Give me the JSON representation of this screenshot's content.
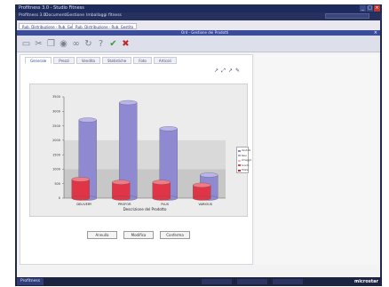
{
  "window": {
    "title": "Profitness 3.0 - Studio Fitness",
    "buttons": [
      "_",
      "□",
      "×"
    ]
  },
  "menubar": {
    "items": [
      "Profitness 3.0",
      "Documenti",
      "Gestione",
      "Imballaggi fitness"
    ]
  },
  "breadcrumbs": [
    "Rub. Distribuzione - Rub. Gestito",
    "Rub. Distribuzione - Rub. Gestito"
  ],
  "module": {
    "title": "Ord - Gestione dei Prodotti"
  },
  "toolbar": {
    "icons": [
      "document-icon",
      "cut-icon",
      "copy-icon",
      "view-icon",
      "link-icon",
      "refresh-icon",
      "help-icon",
      "check-icon",
      "delete-icon"
    ]
  },
  "tabs": [
    {
      "label": "Generale",
      "active": true
    },
    {
      "label": "Prezzi",
      "active": false
    },
    {
      "label": "Vendita",
      "active": false
    },
    {
      "label": "Statistiche",
      "active": false
    },
    {
      "label": "Foto",
      "active": false
    },
    {
      "label": "Articoli",
      "active": false
    }
  ],
  "chart_tools": [
    "↗",
    "⤢",
    "↗",
    "✎"
  ],
  "chart_data": {
    "type": "bar",
    "categories": [
      "DELIVERY",
      "PROFOR",
      "PLUS",
      "VARIOUS"
    ],
    "series": [
      {
        "name": "Venduto",
        "values": [
          2700,
          3300,
          2400,
          800
        ]
      },
      {
        "name": "Reso",
        "values": [
          650,
          550,
          550,
          450
        ]
      }
    ],
    "xlabel": "Descrizione del Prodotto",
    "ylabel": "",
    "ylim": [
      0,
      3500
    ],
    "yticks": [
      0,
      500,
      1000,
      1500,
      2000,
      2500,
      3000,
      3500
    ],
    "legend": [
      "Venduto",
      "Reso",
      "Omaggio",
      "Sconto",
      "Totale"
    ],
    "legend_colors": [
      "#8a86c8",
      "#b0a8d8",
      "#e7b8c0",
      "#d94a5a",
      "#cc2233"
    ],
    "colors": {
      "series1": "#8f89d1",
      "series2": "#e03546"
    }
  },
  "actions": {
    "cancel": "Annulla",
    "modify": "Modifica",
    "save": "Conferma"
  },
  "taskbar": {
    "start": "Profitness",
    "brand": "microstar"
  }
}
